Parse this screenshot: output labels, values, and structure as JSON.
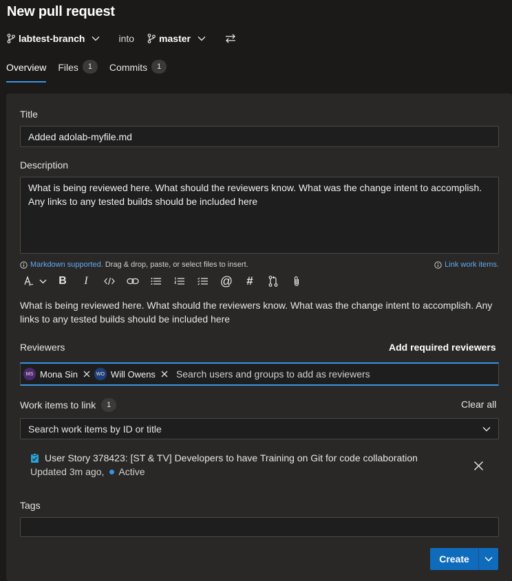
{
  "page": {
    "title": "New pull request"
  },
  "branches": {
    "source": "labtest-branch",
    "into": "into",
    "target": "master",
    "icons": {
      "branch": "branch-icon",
      "chevron": "chevron-down-icon",
      "swap": "swap-arrows-icon"
    }
  },
  "tabs": [
    {
      "label": "Overview",
      "count": null,
      "active": true
    },
    {
      "label": "Files",
      "count": "1",
      "active": false
    },
    {
      "label": "Commits",
      "count": "1",
      "active": false
    }
  ],
  "form": {
    "title_label": "Title",
    "title_value": "Added adolab-myfile.md",
    "description_label": "Description",
    "description_value": "What is being reviewed here. What should the reviewers know. What was the change intent to accomplish. Any links to any tested builds should be included here",
    "markdown_link": "Markdown supported.",
    "markdown_hint": " Drag & drop, paste, or select files to insert.",
    "link_work_items": "Link work items.",
    "preview_text": "What is being reviewed here. What should the reviewers know. What was the change intent to accomplish. Any links to any tested builds should be included here",
    "toolbar": {
      "bold": "B",
      "italic": "I",
      "mention": "@",
      "hash": "#"
    }
  },
  "reviewers": {
    "label": "Reviewers",
    "required_link": "Add required reviewers",
    "placeholder": "Search users and groups to add as reviewers",
    "people": [
      {
        "initials": "MS",
        "name": "Mona Sin",
        "avatar_color": "#4b2a6e"
      },
      {
        "initials": "WO",
        "name": "Will Owens",
        "avatar_color": "#1f3f7a"
      }
    ]
  },
  "work_items": {
    "label": "Work items to link",
    "count": "1",
    "clear_all": "Clear all",
    "search_placeholder": "Search work items by ID or title",
    "item": {
      "title": "User Story 378423: [ST & TV] Developers to have Training on Git for code collaboration",
      "updated": "Updated 3m ago,",
      "state": "Active"
    }
  },
  "tags": {
    "label": "Tags",
    "value": ""
  },
  "actions": {
    "create": "Create"
  },
  "colors": {
    "accent": "#3794e4",
    "primary_button": "#0f6cbd",
    "background": "#1b1a19",
    "card": "#292827"
  }
}
